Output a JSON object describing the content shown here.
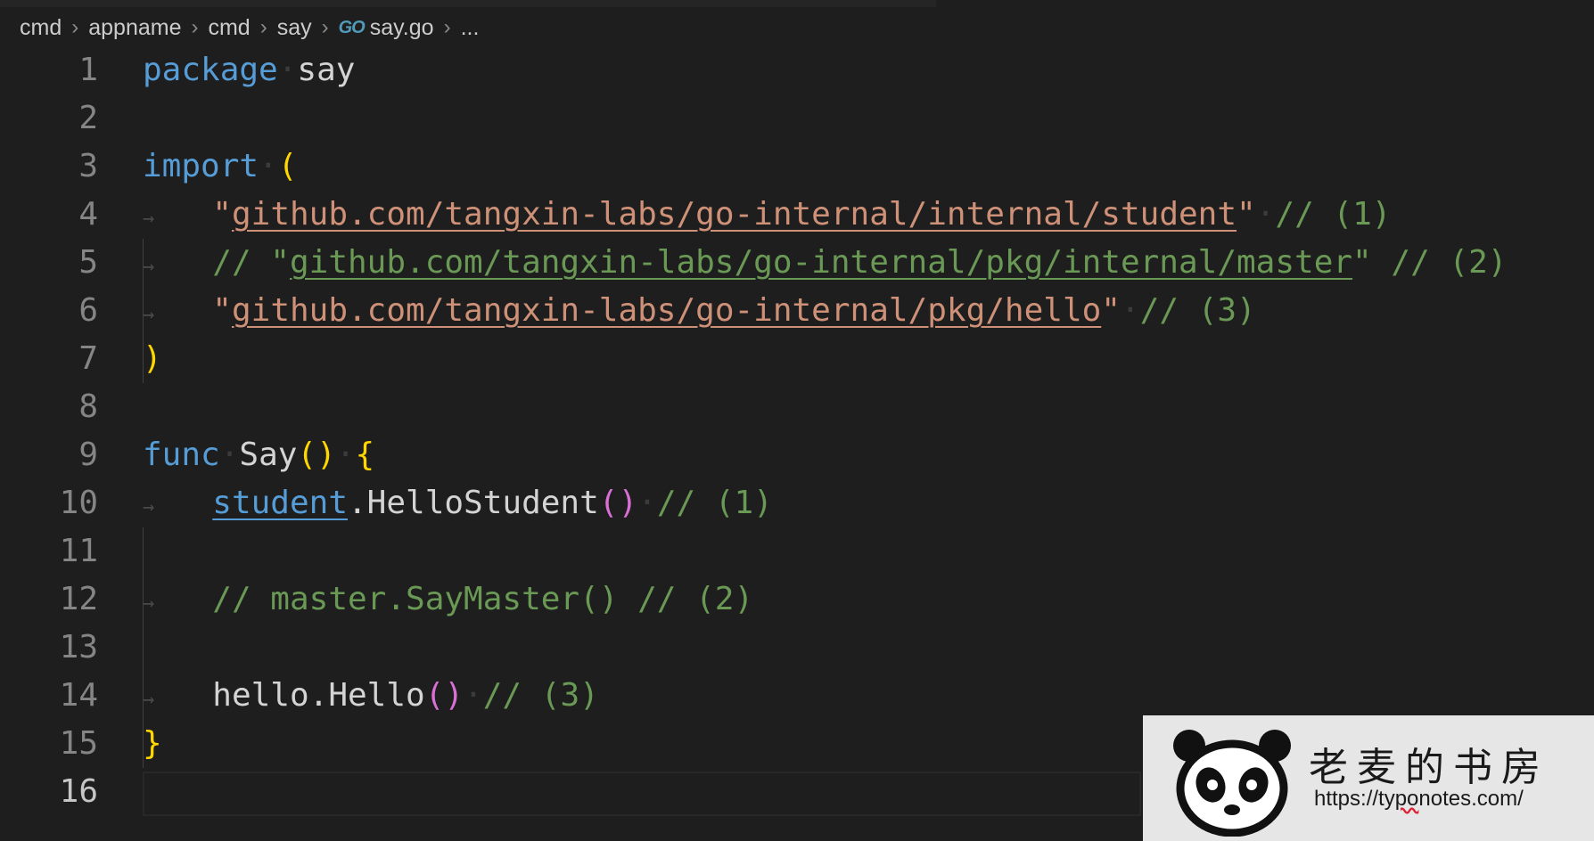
{
  "breadcrumb": {
    "items": [
      "cmd",
      "appname",
      "cmd",
      "say"
    ],
    "file_icon": "GO",
    "file": "say.go",
    "ellipsis": "..."
  },
  "gutter": {
    "line_numbers": [
      "1",
      "2",
      "3",
      "4",
      "5",
      "6",
      "7",
      "8",
      "9",
      "10",
      "11",
      "12",
      "13",
      "14",
      "15",
      "16"
    ],
    "active_line": "16"
  },
  "code": {
    "l1": {
      "kw": "package",
      "name": "say"
    },
    "l3": {
      "kw": "import",
      "paren": "("
    },
    "l4": {
      "q1": "\"",
      "path": "github.com/tangxin-labs/go-internal/internal/student",
      "q2": "\"",
      "comment": "// (1)"
    },
    "l5": {
      "comment_lead": "// \"",
      "path": "github.com/tangxin-labs/go-internal/pkg/internal/master",
      "comment_tail": "\" // (2)"
    },
    "l6": {
      "q1": "\"",
      "path": "github.com/tangxin-labs/go-internal/pkg/hello",
      "q2": "\"",
      "comment": "// (3)"
    },
    "l7": {
      "paren": ")"
    },
    "l9": {
      "kw": "func",
      "name": "Say",
      "parens": "()",
      "brace": "{"
    },
    "l10": {
      "pkg": "student",
      "call": ".HelloStudent",
      "parens": "()",
      "comment": "// (1)"
    },
    "l12": {
      "comment": "// master.SayMaster() // (2)"
    },
    "l14": {
      "pkg": "hello",
      "call": ".Hello",
      "parens": "()",
      "comment": "// (3)"
    },
    "l15": {
      "brace": "}"
    }
  },
  "watermark": {
    "title": "老麦的书房",
    "url_prefix": "https://ty",
    "url_squiggle": "po",
    "url_suffix": "notes.com/"
  },
  "colors": {
    "background": "#1e1e1e",
    "keyword": "#569cd6",
    "string": "#ce9178",
    "comment": "#6a9955",
    "bracket_level1": "#ffd700",
    "bracket_level2": "#da70d6"
  }
}
